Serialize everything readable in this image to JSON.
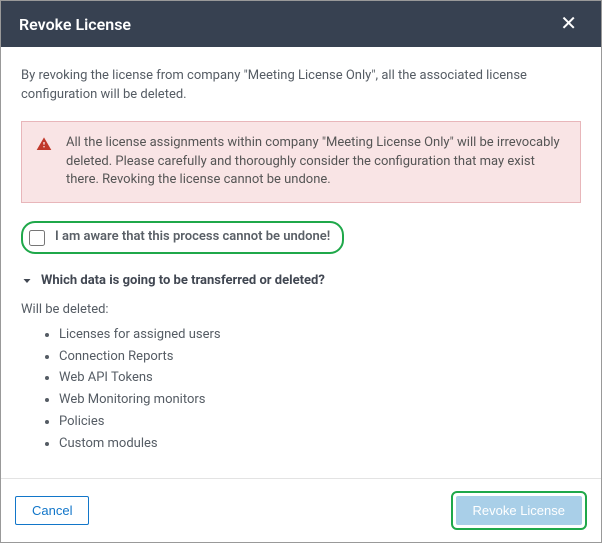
{
  "title": "Revoke License",
  "intro": "By revoking the license from company \"Meeting License Only\", all the associated license configuration will be deleted.",
  "alert_text": "All the license assignments within company \"Meeting License Only\" will be irrevocably deleted. Please carefully and thoroughly consider the configuration that may exist there. Revoking the license cannot be undone.",
  "ack_label": "I am aware that this process cannot be undone!",
  "section_head": "Which data is going to be transferred or deleted?",
  "deleted_heading": "Will be deleted:",
  "deleted_items": {
    "0": "Licenses for assigned users",
    "1": "Connection Reports",
    "2": "Web API Tokens",
    "3": "Web Monitoring monitors",
    "4": "Policies",
    "5": "Custom modules"
  },
  "buttons": {
    "cancel": "Cancel",
    "revoke": "Revoke License"
  }
}
